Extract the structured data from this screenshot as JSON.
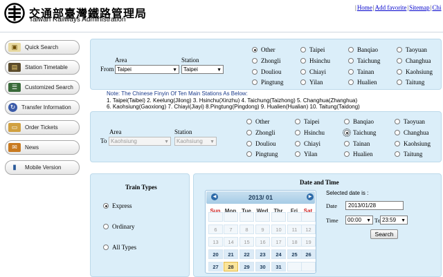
{
  "header": {
    "org_cn": "交通部臺灣鐵路管理局",
    "org_en": "Taiwan Railways Administration",
    "links": [
      "Home",
      "Add favorite",
      "Sitemap",
      "Chi"
    ]
  },
  "sidebar": {
    "items": [
      {
        "label": "Quick Search",
        "icon": "train-icon"
      },
      {
        "label": "Station Timetable",
        "icon": "timetable-icon"
      },
      {
        "label": "Customized Search",
        "icon": "search-icon"
      },
      {
        "label": "Transfer Information",
        "icon": "transfer-icon"
      },
      {
        "label": "Order Tickets",
        "icon": "ticket-icon"
      },
      {
        "label": "News",
        "icon": "news-icon"
      },
      {
        "label": "Mobile Version",
        "icon": "mobile-icon"
      }
    ]
  },
  "from_panel": {
    "area_label": "Area",
    "station_label": "Station",
    "prefix": "From",
    "area_value": "Taipei",
    "station_value": "Taipei",
    "options": [
      "Other",
      "Taipei",
      "Banqiao",
      "Taoyuan",
      "Zhongli",
      "Hsinchu",
      "Taichung",
      "Changhua",
      "Douliou",
      "Chiayi",
      "Tainan",
      "Kaohsiung",
      "Pingtung",
      "Yilan",
      "Hualien",
      "Taitung"
    ],
    "selected": "Other"
  },
  "note": {
    "title": "Note: The Chinese Finyin Of Ten Main Stations As Below:",
    "line1": "1. Taipei(Taibei) 2. Keelung(Jilong) 3. Hsinchu(Xinzhu) 4. Taichung(Taizhong) 5. Changhua(Zhanghua)",
    "line2": "6. Kaohsiung(Gaoxiong) 7. Chiayi(Jiayi) 8.Pingtung(Pingdong) 9. Hualien(Hualian) 10. Taitung(Taidong)"
  },
  "to_panel": {
    "area_label": "Area",
    "station_label": "Station",
    "prefix": "To",
    "area_value": "Kaohsiung",
    "station_value": "Kaohsiung",
    "options": [
      "Other",
      "Taipei",
      "Banqiao",
      "Taoyuan",
      "Zhongli",
      "Hsinchu",
      "Taichung",
      "Changhua",
      "Douliou",
      "Chiayi",
      "Tainan",
      "Kaohsiung",
      "Pingtung",
      "Yilan",
      "Hualien",
      "Taitung"
    ],
    "selected": "Taichung"
  },
  "train_types": {
    "title": "Train Types",
    "options": [
      "Express",
      "Ordinary",
      "All Types"
    ],
    "selected": "Express"
  },
  "datetime": {
    "title": "Date and Time",
    "selected_label": "Selected date is :",
    "date_label": "Date",
    "date_value": "2013/01/28",
    "time_label": "Time",
    "time_from": "00:00",
    "time_to_label": "To",
    "time_to": "23:59",
    "search_label": "Search"
  },
  "calendar": {
    "month_label": "2013/ 01",
    "prev_icon": "chevron-left-icon",
    "next_icon": "chevron-right-icon",
    "days_of_week": [
      "Sun",
      "Mon",
      "Tue",
      "Wed",
      "Thr",
      "Fri",
      "Sat"
    ],
    "weekend_color": "#cc2222",
    "rows": [
      [
        "",
        "",
        "",
        "",
        "",
        "",
        ""
      ],
      [
        "6",
        "7",
        "8",
        "9",
        "10",
        "11",
        "12"
      ],
      [
        "13",
        "14",
        "15",
        "16",
        "17",
        "18",
        "19"
      ],
      [
        "20",
        "21",
        "22",
        "23",
        "24",
        "25",
        "26"
      ],
      [
        "27",
        "28",
        "29",
        "30",
        "31",
        "",
        ""
      ]
    ],
    "today": "28"
  }
}
